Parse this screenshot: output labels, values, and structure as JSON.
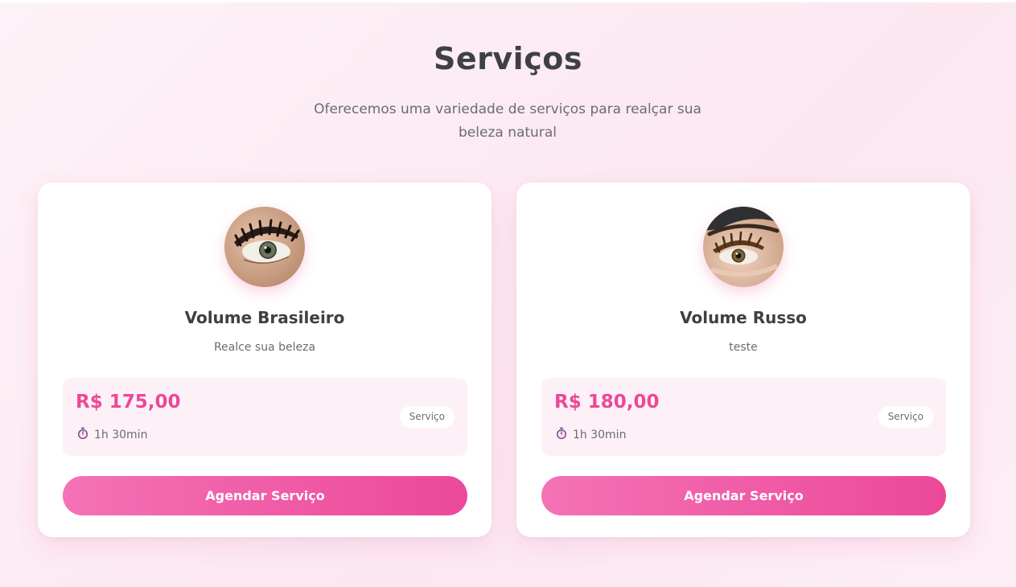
{
  "section": {
    "title": "Serviços",
    "subtitle": "Oferecemos uma variedade de serviços para realçar sua beleza natural"
  },
  "services": [
    {
      "name": "Volume Brasileiro",
      "description": "Realce sua beleza",
      "price": "R$ 175,00",
      "duration": "1h 30min",
      "badge": "Serviço",
      "button_label": "Agendar Serviço",
      "image": "eyelash-extension-photo"
    },
    {
      "name": "Volume Russo",
      "description": "teste",
      "price": "R$ 180,00",
      "duration": "1h 30min",
      "badge": "Serviço",
      "button_label": "Agendar Serviço",
      "image": "eyelash-extension-photo"
    }
  ],
  "icons": {
    "duration": "stopwatch-icon"
  },
  "colors": {
    "accent": "#ec4899",
    "accent_light": "#f472b6",
    "heading": "#3f3f46",
    "muted_text": "#6b6b76",
    "background": "#fce7f1",
    "price_box": "#fdf1f7"
  }
}
